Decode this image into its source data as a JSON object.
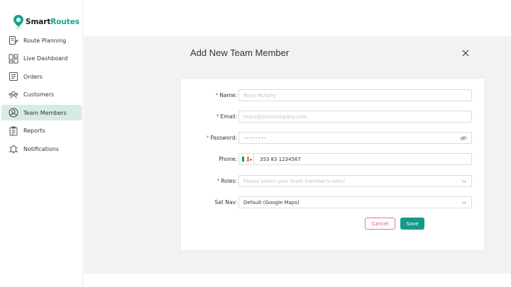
{
  "brand": {
    "name_part1": "Smart",
    "name_part2": "Routes",
    "accent": "#19a38f"
  },
  "sidebar": {
    "items": [
      {
        "label": "Route Planning",
        "icon": "route-planning-icon",
        "active": false
      },
      {
        "label": "Live Dashboard",
        "icon": "dashboard-icon",
        "active": false
      },
      {
        "label": "Orders",
        "icon": "orders-icon",
        "active": false
      },
      {
        "label": "Customers",
        "icon": "customers-icon",
        "active": false
      },
      {
        "label": "Team Members",
        "icon": "team-members-icon",
        "active": true
      },
      {
        "label": "Reports",
        "icon": "reports-icon",
        "active": false
      },
      {
        "label": "Notifications",
        "icon": "bell-icon",
        "active": false
      }
    ]
  },
  "modal": {
    "title": "Add New Team Member",
    "close_icon": "close-icon",
    "fields": {
      "name": {
        "label": "Name:",
        "required": true,
        "placeholder": "Mary Murphy"
      },
      "email": {
        "label": "Email:",
        "required": true,
        "placeholder": "mary@yourcompany.com"
      },
      "password": {
        "label": "Password:",
        "required": true,
        "placeholder": "••••••••"
      },
      "phone": {
        "label": "Phone:",
        "required": false,
        "value": "353 83 1234567",
        "flag": "ireland-flag"
      },
      "roles": {
        "label": "Roles:",
        "required": true,
        "placeholder": "Please select your team member's roles!"
      },
      "satnav": {
        "label": "Sat Nav:",
        "required": false,
        "value": "Default (Google Maps)"
      }
    },
    "cancel_label": "Cancel",
    "save_label": "Save"
  },
  "colors": {
    "save": "#14998a",
    "cancel": "#e05a62",
    "required": "#e0505a",
    "active_nav": "#d6ebe4"
  }
}
